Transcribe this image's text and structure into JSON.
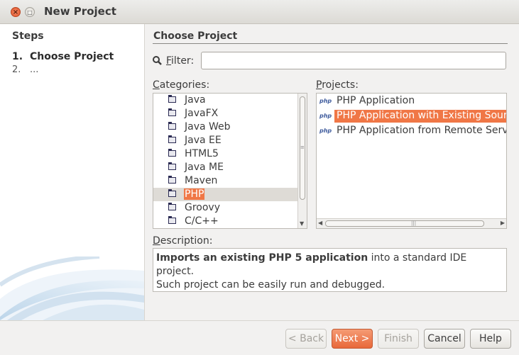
{
  "window": {
    "title": "New Project"
  },
  "steps": {
    "title": "Steps",
    "items": [
      {
        "num": "1.",
        "label": "Choose Project"
      },
      {
        "num": "2.",
        "label": "..."
      }
    ]
  },
  "main": {
    "title": "Choose Project",
    "filter": {
      "label": "Filter:",
      "value": ""
    }
  },
  "categories": {
    "label": "Categories:",
    "items": [
      "Java",
      "JavaFX",
      "Java Web",
      "Java EE",
      "HTML5",
      "Java ME",
      "Maven",
      "PHP",
      "Groovy",
      "C/C++"
    ],
    "selected": "PHP"
  },
  "projects": {
    "label": "Projects:",
    "icon_text": "php",
    "items": [
      "PHP Application",
      "PHP Application with Existing Sourc",
      "PHP Application from Remote Serve"
    ],
    "selected_index": 1
  },
  "description": {
    "label": "Description:",
    "bold_text": "Imports an existing PHP 5 application",
    "rest_text": " into a standard IDE project.",
    "line2": "Such project can be easily run and debugged."
  },
  "buttons": {
    "back": "< Back",
    "next": "Next >",
    "finish": "Finish",
    "cancel": "Cancel",
    "help": "Help"
  },
  "colors": {
    "accent": "#f07746",
    "selection_bg": "#dedbd6"
  }
}
